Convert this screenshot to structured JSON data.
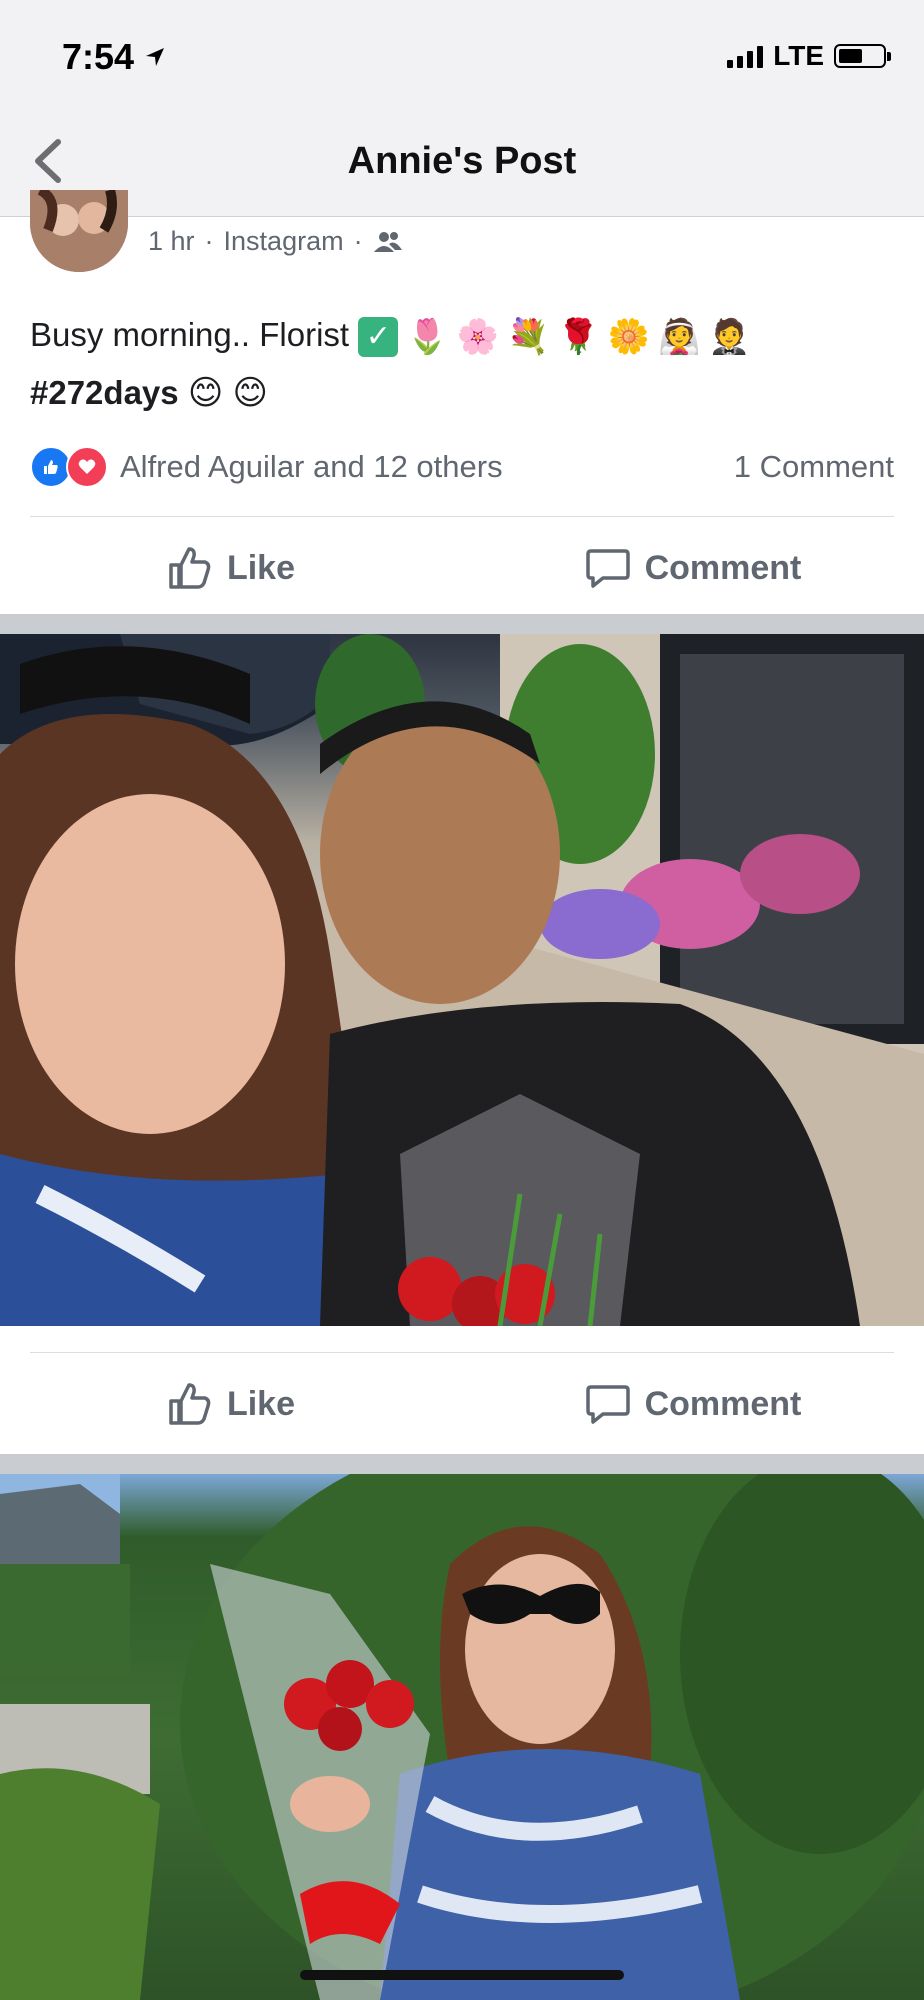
{
  "status_bar": {
    "time": "7:54",
    "network": "LTE"
  },
  "nav": {
    "title": "Annie's Post"
  },
  "post": {
    "meta_time": "1 hr",
    "meta_source": "Instagram",
    "text_main": "Busy morning.. Florist",
    "emojis": [
      "🌷",
      "🌸",
      "💐",
      "🌹",
      "🌼",
      "👰",
      "🤵"
    ],
    "hashtag": "#272days",
    "hashtag_emojis": [
      "😊",
      "😊"
    ],
    "reactions_text": "Alfred Aguilar and 12 others",
    "comments_count": "1 Comment"
  },
  "actions": {
    "like_label": "Like",
    "comment_label": "Comment"
  },
  "colors": {
    "like_blue": "#1877f2",
    "love_red": "#f33e58",
    "text_secondary": "#606770"
  }
}
